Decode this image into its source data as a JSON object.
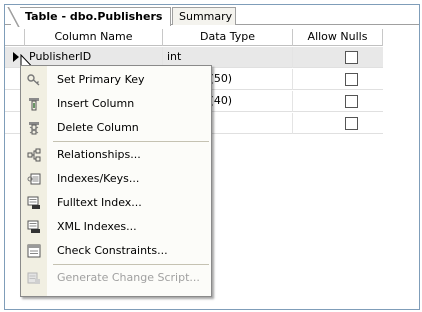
{
  "tabs": {
    "active": "Table - dbo.Publishers",
    "inactive": "Summary"
  },
  "grid": {
    "columns": [
      "Column Name",
      "Data Type",
      "Allow Nulls"
    ],
    "rows": [
      {
        "name": "PublisherID",
        "type": "int",
        "allow_nulls": false
      },
      {
        "name": "",
        "type": "r(50)",
        "allow_nulls": false
      },
      {
        "name": "",
        "type": "r(40)",
        "allow_nulls": false
      },
      {
        "name": "",
        "type": "",
        "allow_nulls": false
      }
    ]
  },
  "context_menu": {
    "items": [
      {
        "label": "Set Primary Key",
        "icon": "primary-key-icon",
        "enabled": true
      },
      {
        "label": "Insert Column",
        "icon": "insert-column-icon",
        "enabled": true
      },
      {
        "label": "Delete Column",
        "icon": "delete-column-icon",
        "enabled": true
      },
      {
        "label": "Relationships...",
        "icon": "relationships-icon",
        "enabled": true
      },
      {
        "label": "Indexes/Keys...",
        "icon": "indexes-keys-icon",
        "enabled": true
      },
      {
        "label": "Fulltext Index...",
        "icon": "fulltext-index-icon",
        "enabled": true
      },
      {
        "label": "XML Indexes...",
        "icon": "xml-indexes-icon",
        "enabled": true
      },
      {
        "label": "Check Constraints...",
        "icon": "check-constraints-icon",
        "enabled": true
      },
      {
        "label": "Generate Change Script...",
        "icon": "generate-script-icon",
        "enabled": false
      }
    ]
  }
}
